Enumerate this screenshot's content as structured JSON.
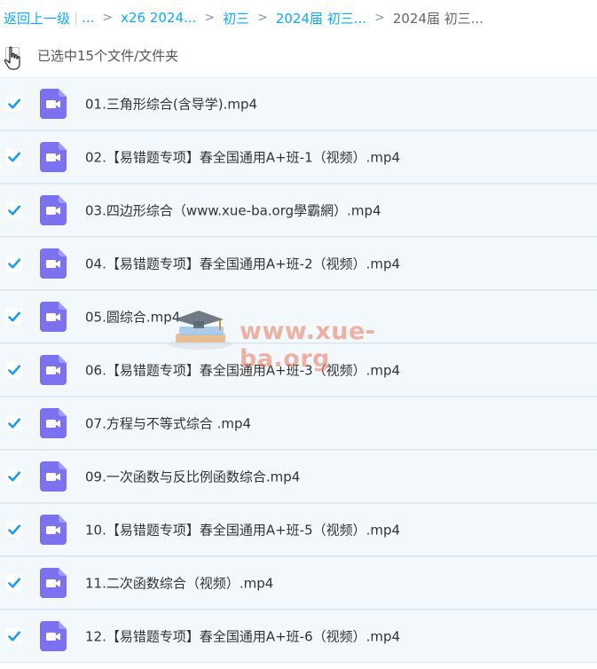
{
  "breadcrumb": {
    "back": "返回上一级",
    "separator_bar": "|",
    "ellipsis": "...",
    "sep": ">",
    "items": [
      "x26 2024...",
      "初三",
      "2024届 初三..."
    ],
    "current": "2024届 初三..."
  },
  "selection": {
    "label": "已选中15个文件/文件夹"
  },
  "files": [
    {
      "name": "01.三角形综合(含导学).mp4"
    },
    {
      "name": "02.【易错题专项】春全国通用A+班-1（视频）.mp4"
    },
    {
      "name": "03.四边形综合（www.xue-ba.org學霸網）.mp4"
    },
    {
      "name": "04.【易错题专项】春全国通用A+班-2（视频）.mp4"
    },
    {
      "name": "05.圆综合.mp4"
    },
    {
      "name": "06.【易错题专项】春全国通用A+班-3（视频）.mp4"
    },
    {
      "name": "07.方程与不等式综合 .mp4"
    },
    {
      "name": "09.一次函数与反比例函数综合.mp4"
    },
    {
      "name": "10.【易错题专项】春全国通用A+班-5（视频）.mp4"
    },
    {
      "name": "11.二次函数综合（视频）.mp4"
    },
    {
      "name": "12.【易错题专项】春全国通用A+班-6（视频）.mp4"
    }
  ],
  "watermark": {
    "text": "www.xue-ba.org",
    "icon": "graduation-cap-books-icon"
  },
  "colors": {
    "accent": "#09AAFF",
    "checkbox": "#1e9af0",
    "video_icon": "#7C72F0",
    "row_bg": "#f3f8fc"
  }
}
